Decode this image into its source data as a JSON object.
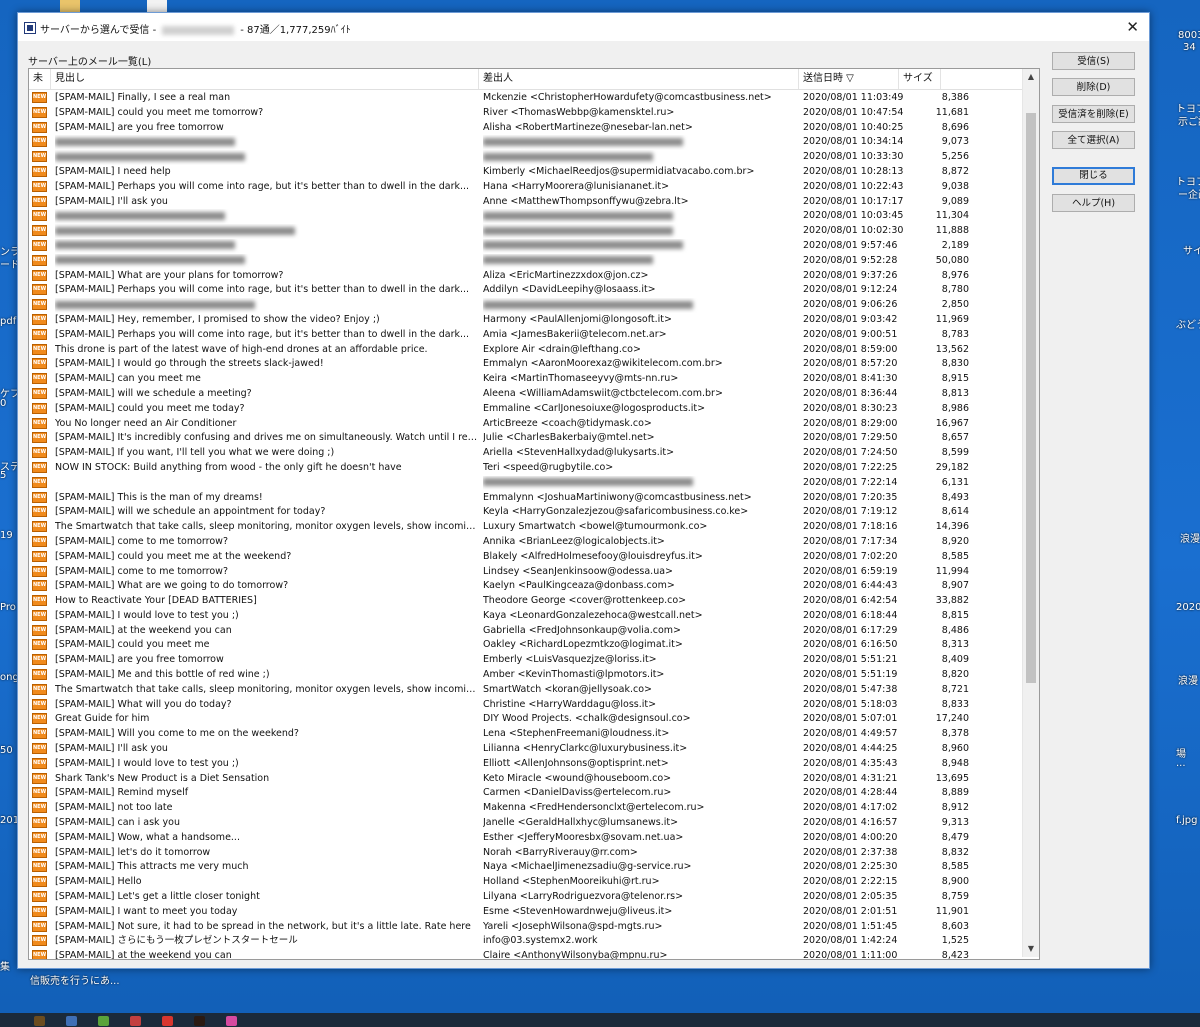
{
  "window": {
    "title_prefix": "サーバーから選んで受信 -",
    "title_suffix": "- 87通／1,777,259ﾊﾞｲﾄ",
    "close_label": "✕"
  },
  "list_caption": "サーバー上のメール一覧(L)",
  "columns": {
    "unread": "未",
    "subject": "見出し",
    "from": "差出人",
    "date": "送信日時 ▽",
    "size": "サイズ"
  },
  "buttons": {
    "receive": "受信(S)",
    "delete": "削除(D)",
    "delete_received": "受信済を削除(E)",
    "select_all": "全て選択(A)",
    "close": "閉じる",
    "help": "ヘルプ(H)"
  },
  "new_icon_label": "NEW",
  "desktop_labels": [
    "8003",
    "34",
    "トヨフェ",
    "示ご説",
    "トヨフェ",
    "ー企画",
    "サイ",
    "ンラ",
    "ード",
    "pdf",
    "ぶどう",
    "ケフ",
    "0",
    "ステ",
    "5",
    "19",
    "浪漫",
    "2020",
    "Pro",
    "浪漫",
    "ong",
    "50",
    "場",
    "...",
    "201",
    "f.jpg",
    "集",
    "信販売を行うにあ..."
  ],
  "rows": [
    {
      "subject": "[SPAM-MAIL] Finally, I see a real man",
      "from": "Mckenzie <ChristopherHowardufety@comcastbusiness.net>",
      "date": "2020/08/01 11:03:49",
      "size": "8,386"
    },
    {
      "subject": "[SPAM-MAIL] could you meet me tomorrow?",
      "from": "River <ThomasWebbp@kamensktel.ru>",
      "date": "2020/08/01 10:47:54",
      "size": "11,681"
    },
    {
      "subject": "[SPAM-MAIL] are you free tomorrow",
      "from": "Alisha <RobertMartineze@nesebar-lan.net>",
      "date": "2020/08/01 10:40:25",
      "size": "8,696"
    },
    {
      "subject": "",
      "from": "",
      "date": "2020/08/01 10:34:14",
      "size": "9,073",
      "blur": true
    },
    {
      "subject": "",
      "from": "",
      "date": "2020/08/01 10:33:30",
      "size": "5,256",
      "blur": true
    },
    {
      "subject": "[SPAM-MAIL] I need help",
      "from": "Kimberly <MichaelReedjos@supermidiatvacabo.com.br>",
      "date": "2020/08/01 10:28:13",
      "size": "8,872"
    },
    {
      "subject": "[SPAM-MAIL] Perhaps you will come into rage, but it's better than to dwell in the dark...",
      "from": "Hana <HarryMoorera@lunisiananet.it>",
      "date": "2020/08/01 10:22:43",
      "size": "9,038"
    },
    {
      "subject": "[SPAM-MAIL] I'll ask you",
      "from": "Anne <MatthewThompsonffywu@zebra.lt>",
      "date": "2020/08/01 10:17:17",
      "size": "9,089"
    },
    {
      "subject": "",
      "from": "",
      "date": "2020/08/01 10:03:45",
      "size": "11,304",
      "blur": true
    },
    {
      "subject": "",
      "from": "",
      "date": "2020/08/01 10:02:30",
      "size": "11,888",
      "blur": true
    },
    {
      "subject": "",
      "from": "",
      "date": "2020/08/01 9:57:46",
      "size": "2,189",
      "blur": true
    },
    {
      "subject": "",
      "from": "",
      "date": "2020/08/01 9:52:28",
      "size": "50,080",
      "blur": true
    },
    {
      "subject": "[SPAM-MAIL] What are your plans for tomorrow?",
      "from": "Aliza <EricMartinezzxdox@jon.cz>",
      "date": "2020/08/01 9:37:26",
      "size": "8,976"
    },
    {
      "subject": "[SPAM-MAIL] Perhaps you will come into rage, but it's better than to dwell in the dark...",
      "from": "Addilyn <DavidLeepihy@losaass.it>",
      "date": "2020/08/01 9:12:24",
      "size": "8,780"
    },
    {
      "subject": "",
      "from": "",
      "date": "2020/08/01 9:06:26",
      "size": "2,850",
      "blur": true
    },
    {
      "subject": "[SPAM-MAIL] Hey, remember, I promised to show the video? Enjoy ;)",
      "from": "Harmony <PaulAllenjomi@longosoft.it>",
      "date": "2020/08/01 9:03:42",
      "size": "11,969"
    },
    {
      "subject": "[SPAM-MAIL] Perhaps you will come into rage, but it's better than to dwell in the dark...",
      "from": "Amia <JamesBakerii@telecom.net.ar>",
      "date": "2020/08/01 9:00:51",
      "size": "8,783"
    },
    {
      "subject": "This drone is part of the latest wave of high-end drones at an affordable price.",
      "from": "Explore Air <drain@lefthang.co>",
      "date": "2020/08/01 8:59:00",
      "size": "13,562"
    },
    {
      "subject": "[SPAM-MAIL] I would go through the streets slack-jawed!",
      "from": "Emmalyn <AaronMoorexaz@wikitelecom.com.br>",
      "date": "2020/08/01 8:57:20",
      "size": "8,830"
    },
    {
      "subject": "[SPAM-MAIL] can you meet me",
      "from": "Keira <MartinThomaseeyvy@mts-nn.ru>",
      "date": "2020/08/01 8:41:30",
      "size": "8,915"
    },
    {
      "subject": "[SPAM-MAIL] will we schedule a meeting?",
      "from": "Aleena <WilliamAdamswiit@ctbctelecom.com.br>",
      "date": "2020/08/01 8:36:44",
      "size": "8,813"
    },
    {
      "subject": "[SPAM-MAIL] could you meet me today?",
      "from": "Emmaline <CarlJonesoiuxe@logosproducts.it>",
      "date": "2020/08/01 8:30:23",
      "size": "8,986"
    },
    {
      "subject": "You No longer need an Air Conditioner",
      "from": "ArticBreeze <coach@tidymask.co>",
      "date": "2020/08/01 8:29:00",
      "size": "16,967"
    },
    {
      "subject": "[SPAM-MAIL] It's incredibly confusing and drives me on simultaneously. Watch until I remove...",
      "from": "Julie <CharlesBakerbaiy@mtel.net>",
      "date": "2020/08/01 7:29:50",
      "size": "8,657"
    },
    {
      "subject": "[SPAM-MAIL] If you want, I'll tell you what we were doing ;)",
      "from": "Ariella <StevenHallxydad@lukysarts.it>",
      "date": "2020/08/01 7:24:50",
      "size": "8,599"
    },
    {
      "subject": "NOW IN STOCK: Build anything from wood - the only gift he doesn't have",
      "from": " Teri <speed@rugbytile.co>",
      "date": "2020/08/01 7:22:25",
      "size": "29,182"
    },
    {
      "subject": "",
      "from": "",
      "date": "2020/08/01 7:22:14",
      "size": "6,131",
      "blurFromOnly": true
    },
    {
      "subject": "[SPAM-MAIL] This is the man of my dreams!",
      "from": "Emmalynn <JoshuaMartiniwony@comcastbusiness.net>",
      "date": "2020/08/01 7:20:35",
      "size": "8,493"
    },
    {
      "subject": "[SPAM-MAIL] will we schedule an appointment for today?",
      "from": "Keyla <HarryGonzalezjezou@safaricombusiness.co.ke>",
      "date": "2020/08/01 7:19:12",
      "size": "8,614"
    },
    {
      "subject": "The Smartwatch that take calls, sleep monitoring, monitor oxygen levels, show incoming mess...",
      "from": "Luxury Smartwatch <bowel@tumourmonk.co>",
      "date": "2020/08/01 7:18:16",
      "size": "14,396"
    },
    {
      "subject": "[SPAM-MAIL] come to me tomorrow?",
      "from": "Annika <BrianLeez@logicalobjects.it>",
      "date": "2020/08/01 7:17:34",
      "size": "8,920"
    },
    {
      "subject": "[SPAM-MAIL] could you meet me at the weekend?",
      "from": "Blakely <AlfredHolmesefooy@louisdreyfus.it>",
      "date": "2020/08/01 7:02:20",
      "size": "8,585"
    },
    {
      "subject": "[SPAM-MAIL] come to me tomorrow?",
      "from": "Lindsey <SeanJenkinsoow@odessa.ua>",
      "date": "2020/08/01 6:59:19",
      "size": "11,994"
    },
    {
      "subject": "[SPAM-MAIL] What are we going to do tomorrow?",
      "from": "Kaelyn <PaulKingceaza@donbass.com>",
      "date": "2020/08/01 6:44:43",
      "size": "8,907"
    },
    {
      "subject": "How to Reactivate Your [DEAD BATTERIES]",
      "from": " Theodore George <cover@rottenkeep.co>",
      "date": "2020/08/01 6:42:54",
      "size": "33,882"
    },
    {
      "subject": "[SPAM-MAIL] I would love to test you ;)",
      "from": "Kaya <LeonardGonzalezehoca@westcall.net>",
      "date": "2020/08/01 6:18:44",
      "size": "8,815"
    },
    {
      "subject": "[SPAM-MAIL] at the weekend you can",
      "from": "Gabriella <FredJohnsonkaup@volia.com>",
      "date": "2020/08/01 6:17:29",
      "size": "8,486"
    },
    {
      "subject": "[SPAM-MAIL] could you meet me",
      "from": "Oakley <RichardLopezmtkzo@logimat.it>",
      "date": "2020/08/01 6:16:50",
      "size": "8,313"
    },
    {
      "subject": "[SPAM-MAIL] are you free tomorrow",
      "from": "Emberly <LuisVasquezjze@loriss.it>",
      "date": "2020/08/01 5:51:21",
      "size": "8,409"
    },
    {
      "subject": "[SPAM-MAIL] Me and this bottle of red wine ;)",
      "from": "Amber <KevinThomasti@lpmotors.it>",
      "date": "2020/08/01 5:51:19",
      "size": "8,820"
    },
    {
      "subject": "The Smartwatch that take calls, sleep monitoring, monitor oxygen levels, show incoming mess...",
      "from": "SmartWatch <koran@jellysoak.co>",
      "date": "2020/08/01 5:47:38",
      "size": "8,721"
    },
    {
      "subject": "[SPAM-MAIL] What will you do today?",
      "from": "Christine <HarryWarddagu@loss.it>",
      "date": "2020/08/01 5:18:03",
      "size": "8,833"
    },
    {
      "subject": "Great Guide for him",
      "from": "DIY Wood Projects. <chalk@designsoul.co>",
      "date": "2020/08/01 5:07:01",
      "size": "17,240"
    },
    {
      "subject": "[SPAM-MAIL] Will you come to me on the weekend?",
      "from": "Lena <StephenFreemani@loudness.it>",
      "date": "2020/08/01 4:49:57",
      "size": "8,378"
    },
    {
      "subject": "[SPAM-MAIL] I'll ask you",
      "from": "Lilianna <HenryClarkc@luxurybusiness.it>",
      "date": "2020/08/01 4:44:25",
      "size": "8,960"
    },
    {
      "subject": "[SPAM-MAIL] I would love to test you ;)",
      "from": "Elliott <AllenJohnsons@optisprint.net>",
      "date": "2020/08/01 4:35:43",
      "size": "8,948"
    },
    {
      "subject": "Shark Tank's New Product is a Diet Sensation",
      "from": "Keto Miracle <wound@houseboom.co>",
      "date": "2020/08/01 4:31:21",
      "size": "13,695"
    },
    {
      "subject": "[SPAM-MAIL] Remind myself",
      "from": "Carmen <DanielDaviss@ertelecom.ru>",
      "date": "2020/08/01 4:28:44",
      "size": "8,889"
    },
    {
      "subject": "[SPAM-MAIL] not too late",
      "from": "Makenna <FredHendersonclxt@ertelecom.ru>",
      "date": "2020/08/01 4:17:02",
      "size": "8,912"
    },
    {
      "subject": "[SPAM-MAIL] can i ask you",
      "from": "Janelle <GeraldHallxhyc@lumsanews.it>",
      "date": "2020/08/01 4:16:57",
      "size": "9,313"
    },
    {
      "subject": "[SPAM-MAIL] Wow, what a handsome...",
      "from": "Esther <JefferyMooresbx@sovam.net.ua>",
      "date": "2020/08/01 4:00:20",
      "size": "8,479"
    },
    {
      "subject": "[SPAM-MAIL] let's do it tomorrow",
      "from": "Norah <BarryRiverauy@rr.com>",
      "date": "2020/08/01 2:37:38",
      "size": "8,832"
    },
    {
      "subject": "[SPAM-MAIL] This attracts me very much",
      "from": "Naya <MichaelJimenezsadiu@g-service.ru>",
      "date": "2020/08/01 2:25:30",
      "size": "8,585"
    },
    {
      "subject": "[SPAM-MAIL] Hello",
      "from": "Holland <StephenMooreikuhi@rt.ru>",
      "date": "2020/08/01 2:22:15",
      "size": "8,900"
    },
    {
      "subject": "[SPAM-MAIL] Let's get a little closer tonight",
      "from": "Lilyana <LarryRodriguezvora@telenor.rs>",
      "date": "2020/08/01 2:05:35",
      "size": "8,759"
    },
    {
      "subject": "[SPAM-MAIL] I want to meet you today",
      "from": "Esme <StevenHowardnweju@liveus.it>",
      "date": "2020/08/01 2:01:51",
      "size": "11,901"
    },
    {
      "subject": "[SPAM-MAIL] Not sure, it had to be spread in the network, but it's a little late. Rate here",
      "from": "Yareli <JosephWilsona@spd-mgts.ru>",
      "date": "2020/08/01 1:51:45",
      "size": "8,603"
    },
    {
      "subject": "[SPAM-MAIL] さらにもう一枚プレゼントスタートセール",
      "from": "info@03.systemx2.work",
      "date": "2020/08/01 1:42:24",
      "size": "1,525"
    },
    {
      "subject": "[SPAM-MAIL] at the weekend you can",
      "from": "Claire <AnthonyWilsonyba@mpnu.ru>",
      "date": "2020/08/01 1:11:00",
      "size": "8,423"
    }
  ]
}
